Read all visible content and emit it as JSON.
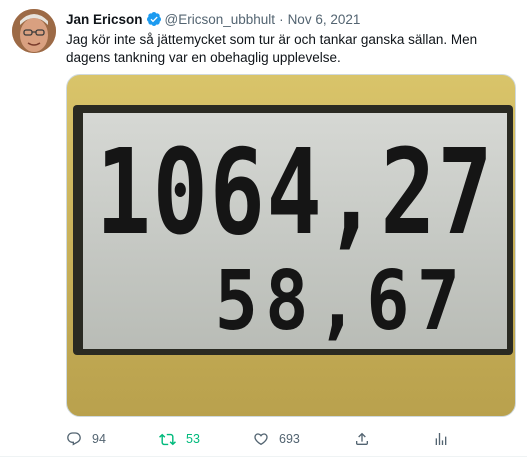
{
  "author": {
    "name": "Jan Ericson",
    "handle": "@Ericson_ubbhult",
    "separator": "·",
    "date": "Nov 6, 2021"
  },
  "tweet": {
    "text": "Jag kör inte så jättemycket som tur är och tankar ganska sällan. Men dagens tankning var en obehaglig upplevelse."
  },
  "display": {
    "amount": "1064,27",
    "volume": "58,67"
  },
  "actions": {
    "replies": "94",
    "retweets": "53",
    "likes": "693"
  },
  "icons": {
    "verified": "verified-badge-icon",
    "reply": "reply-icon",
    "retweet": "retweet-icon",
    "like": "heart-icon",
    "share": "share-icon",
    "analytics": "analytics-icon"
  },
  "colors": {
    "verified": "#1d9bf0",
    "retweet": "#00ba7c",
    "secondary": "#536471"
  }
}
